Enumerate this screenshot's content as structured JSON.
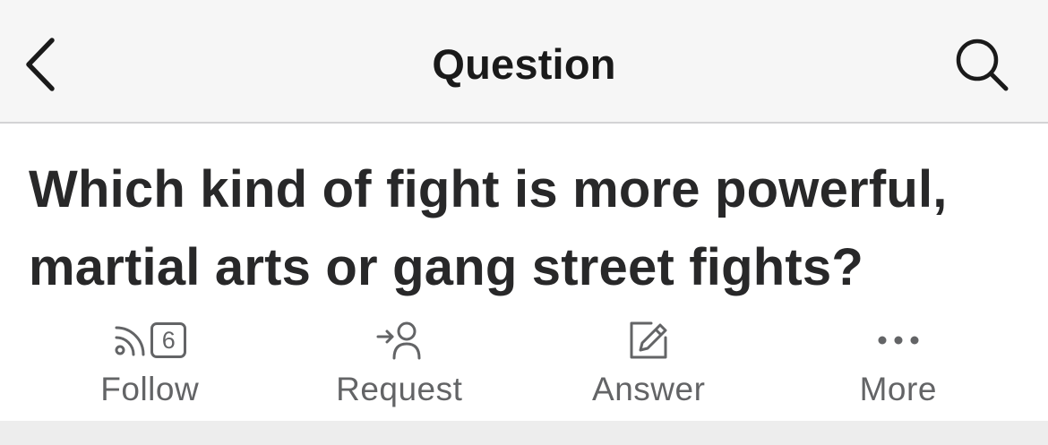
{
  "nav": {
    "title": "Question",
    "back_icon": "chevron-left-icon",
    "search_icon": "search-icon"
  },
  "question": {
    "text": "Which kind of fight is more powerful, martial arts or gang street fights?"
  },
  "actions": {
    "follow": {
      "label": "Follow",
      "count": "6",
      "icon": "rss-icon"
    },
    "request": {
      "label": "Request",
      "icon": "request-user-icon"
    },
    "answer": {
      "label": "Answer",
      "icon": "edit-pencil-icon"
    },
    "more": {
      "label": "More",
      "icon": "more-dots-icon"
    }
  },
  "colors": {
    "nav_bg": "#f6f6f6",
    "text_primary": "#282829",
    "text_secondary": "#636466",
    "divider": "#d3d3d5",
    "footer_bg": "#ededed"
  }
}
